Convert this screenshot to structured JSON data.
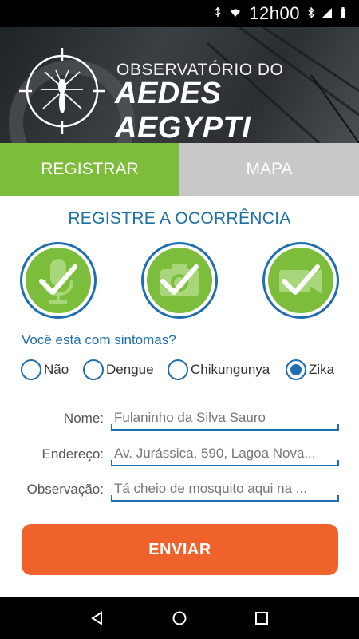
{
  "status_bar": {
    "time": "12h00"
  },
  "header": {
    "title_line1": "OBSERVATÓRIO DO",
    "title_line2": "AEDES AEGYPTI"
  },
  "tabs": [
    {
      "label": "REGISTRAR",
      "active": true
    },
    {
      "label": "MAPA",
      "active": false
    }
  ],
  "section_title": "REGISTRE A OCORRÊNCIA",
  "media_buttons": [
    {
      "icon": "microphone-icon"
    },
    {
      "icon": "camera-icon"
    },
    {
      "icon": "video-icon"
    }
  ],
  "symptoms": {
    "question": "Você está com sintomas?",
    "options": [
      {
        "label": "Não",
        "checked": false
      },
      {
        "label": "Dengue",
        "checked": false
      },
      {
        "label": "Chikungunya",
        "checked": false
      },
      {
        "label": "Zika",
        "checked": true
      }
    ]
  },
  "form": {
    "name": {
      "label": "Nome:",
      "value": "Fulaninho da Silva Sauro"
    },
    "address": {
      "label": "Endereço:",
      "value": "Av. Jurássica, 590, Lagoa Nova..."
    },
    "note": {
      "label": "Observação:",
      "value": "Tá cheio de mosquito aqui na ..."
    }
  },
  "submit_label": "ENVIAR",
  "colors": {
    "green": "#7cbd3b",
    "blue": "#1f6fb0",
    "orange": "#f0622c",
    "tab_inactive": "#c8c8c8"
  }
}
